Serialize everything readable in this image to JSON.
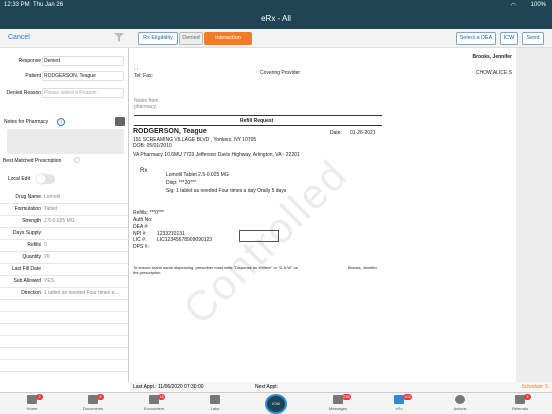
{
  "status": {
    "time": "12:33 PM",
    "date": "Thu Jan 26",
    "battery": "100%"
  },
  "nav": {
    "title": "eRx - All"
  },
  "toolbar": {
    "cancel": "Cancel",
    "tabs": [
      "Rx Eligibility",
      "Denied",
      "Interaction"
    ],
    "select_dea": "Select a DEA",
    "icw": "ICW",
    "send": "Send"
  },
  "form": {
    "response_label": "Response",
    "response_value": "Denied",
    "patient_label": "Patient",
    "patient_value": "RODGERSON, Teague",
    "denied_reason_label": "Denied Reason",
    "denied_reason_placeholder": "Please select a Reason",
    "notes_label": "Notes for Pharmacy",
    "best_matched_label": "Best Matched Prescription",
    "local_edit_label": "Local Edit",
    "drug_name_label": "Drug Name",
    "drug_name_value": "Lomotil",
    "formulation_label": "Formulation",
    "formulation_value": "Tablet",
    "strength_label": "Strength",
    "strength_value": "2.5-0.025 MG",
    "days_supply_label": "Days Supply",
    "refills_label": "Refills",
    "refills_value": "0",
    "quantity_label": "Quantity",
    "quantity_value": "20",
    "last_fill_label": "Last Fill Date",
    "sub_allowed_label": "Sub Allowed",
    "sub_allowed_value": "YES",
    "direction_label": "Direction",
    "direction_value": "1 tablet as needed Four times a..."
  },
  "doc": {
    "provider_name": "Brooks, Jennifer",
    "dots": ", ,",
    "tel_fax": "Tel: Fax:",
    "covering_provider": "Covering Provider",
    "covering_name": "CHOW,ALICE S",
    "notes_from_pharmacy": "Notes from pharmacy:",
    "refill_request": "Refill Request",
    "patient_name": "RODGERSON, Teague",
    "date_label": "Date:",
    "date_value": "01-26-2021",
    "patient_address": "191 SCREAMING VILLAGE BLVD , Yonkers, NY 10705",
    "dob": "DOB:  05/01/2010",
    "pharmacy": "VA Pharmacy 10.6MU 7723 Jefferson Davis Highway, Arlington, VA - 22201",
    "rx": "Rx",
    "drug_line": "Lomotil Tablet 2.5-0.025 MG",
    "disp_line": "Disp:   ***20***",
    "sig_line": "Sig:     1 tablet as needed Four times a day Orally 5 days",
    "refills_line": "Refills:        ***0***",
    "auth_no": "Auth No:",
    "dea": "DEA #:",
    "npi": "NPI #:",
    "npi_value": "1233210131",
    "lic": "LIC #:",
    "lic_value": "LIC12345678909090123",
    "dps": "DPS #:",
    "disclaimer": "To ensure brand name dispensing, prescriber must write \"Dispense as Written\" or \"D.A.W\" on the prescription.",
    "signer": "Brooks, Jennifer",
    "watermark": "Controlled"
  },
  "infobar": {
    "last_appt": "Last Appt.: 11/06/2020 07:30:00",
    "next_appt": "Next Appt:",
    "schedule": "Schedule: 5"
  },
  "tabbar": {
    "items": [
      {
        "label": "Home",
        "badge": "2"
      },
      {
        "label": "Documents",
        "badge": "6"
      },
      {
        "label": "Encounters",
        "badge": "15"
      },
      {
        "label": "Labs",
        "badge": ""
      },
      {
        "label": "Messages",
        "badge": "235"
      },
      {
        "label": "eRx",
        "badge": "102"
      },
      {
        "label": "Actions",
        "badge": ""
      },
      {
        "label": "Referrals",
        "badge": "4"
      }
    ],
    "center": "ICW"
  },
  "colors": {
    "nav": "#1f4453",
    "accent": "#f27b2a",
    "link": "#2a7bd8"
  }
}
